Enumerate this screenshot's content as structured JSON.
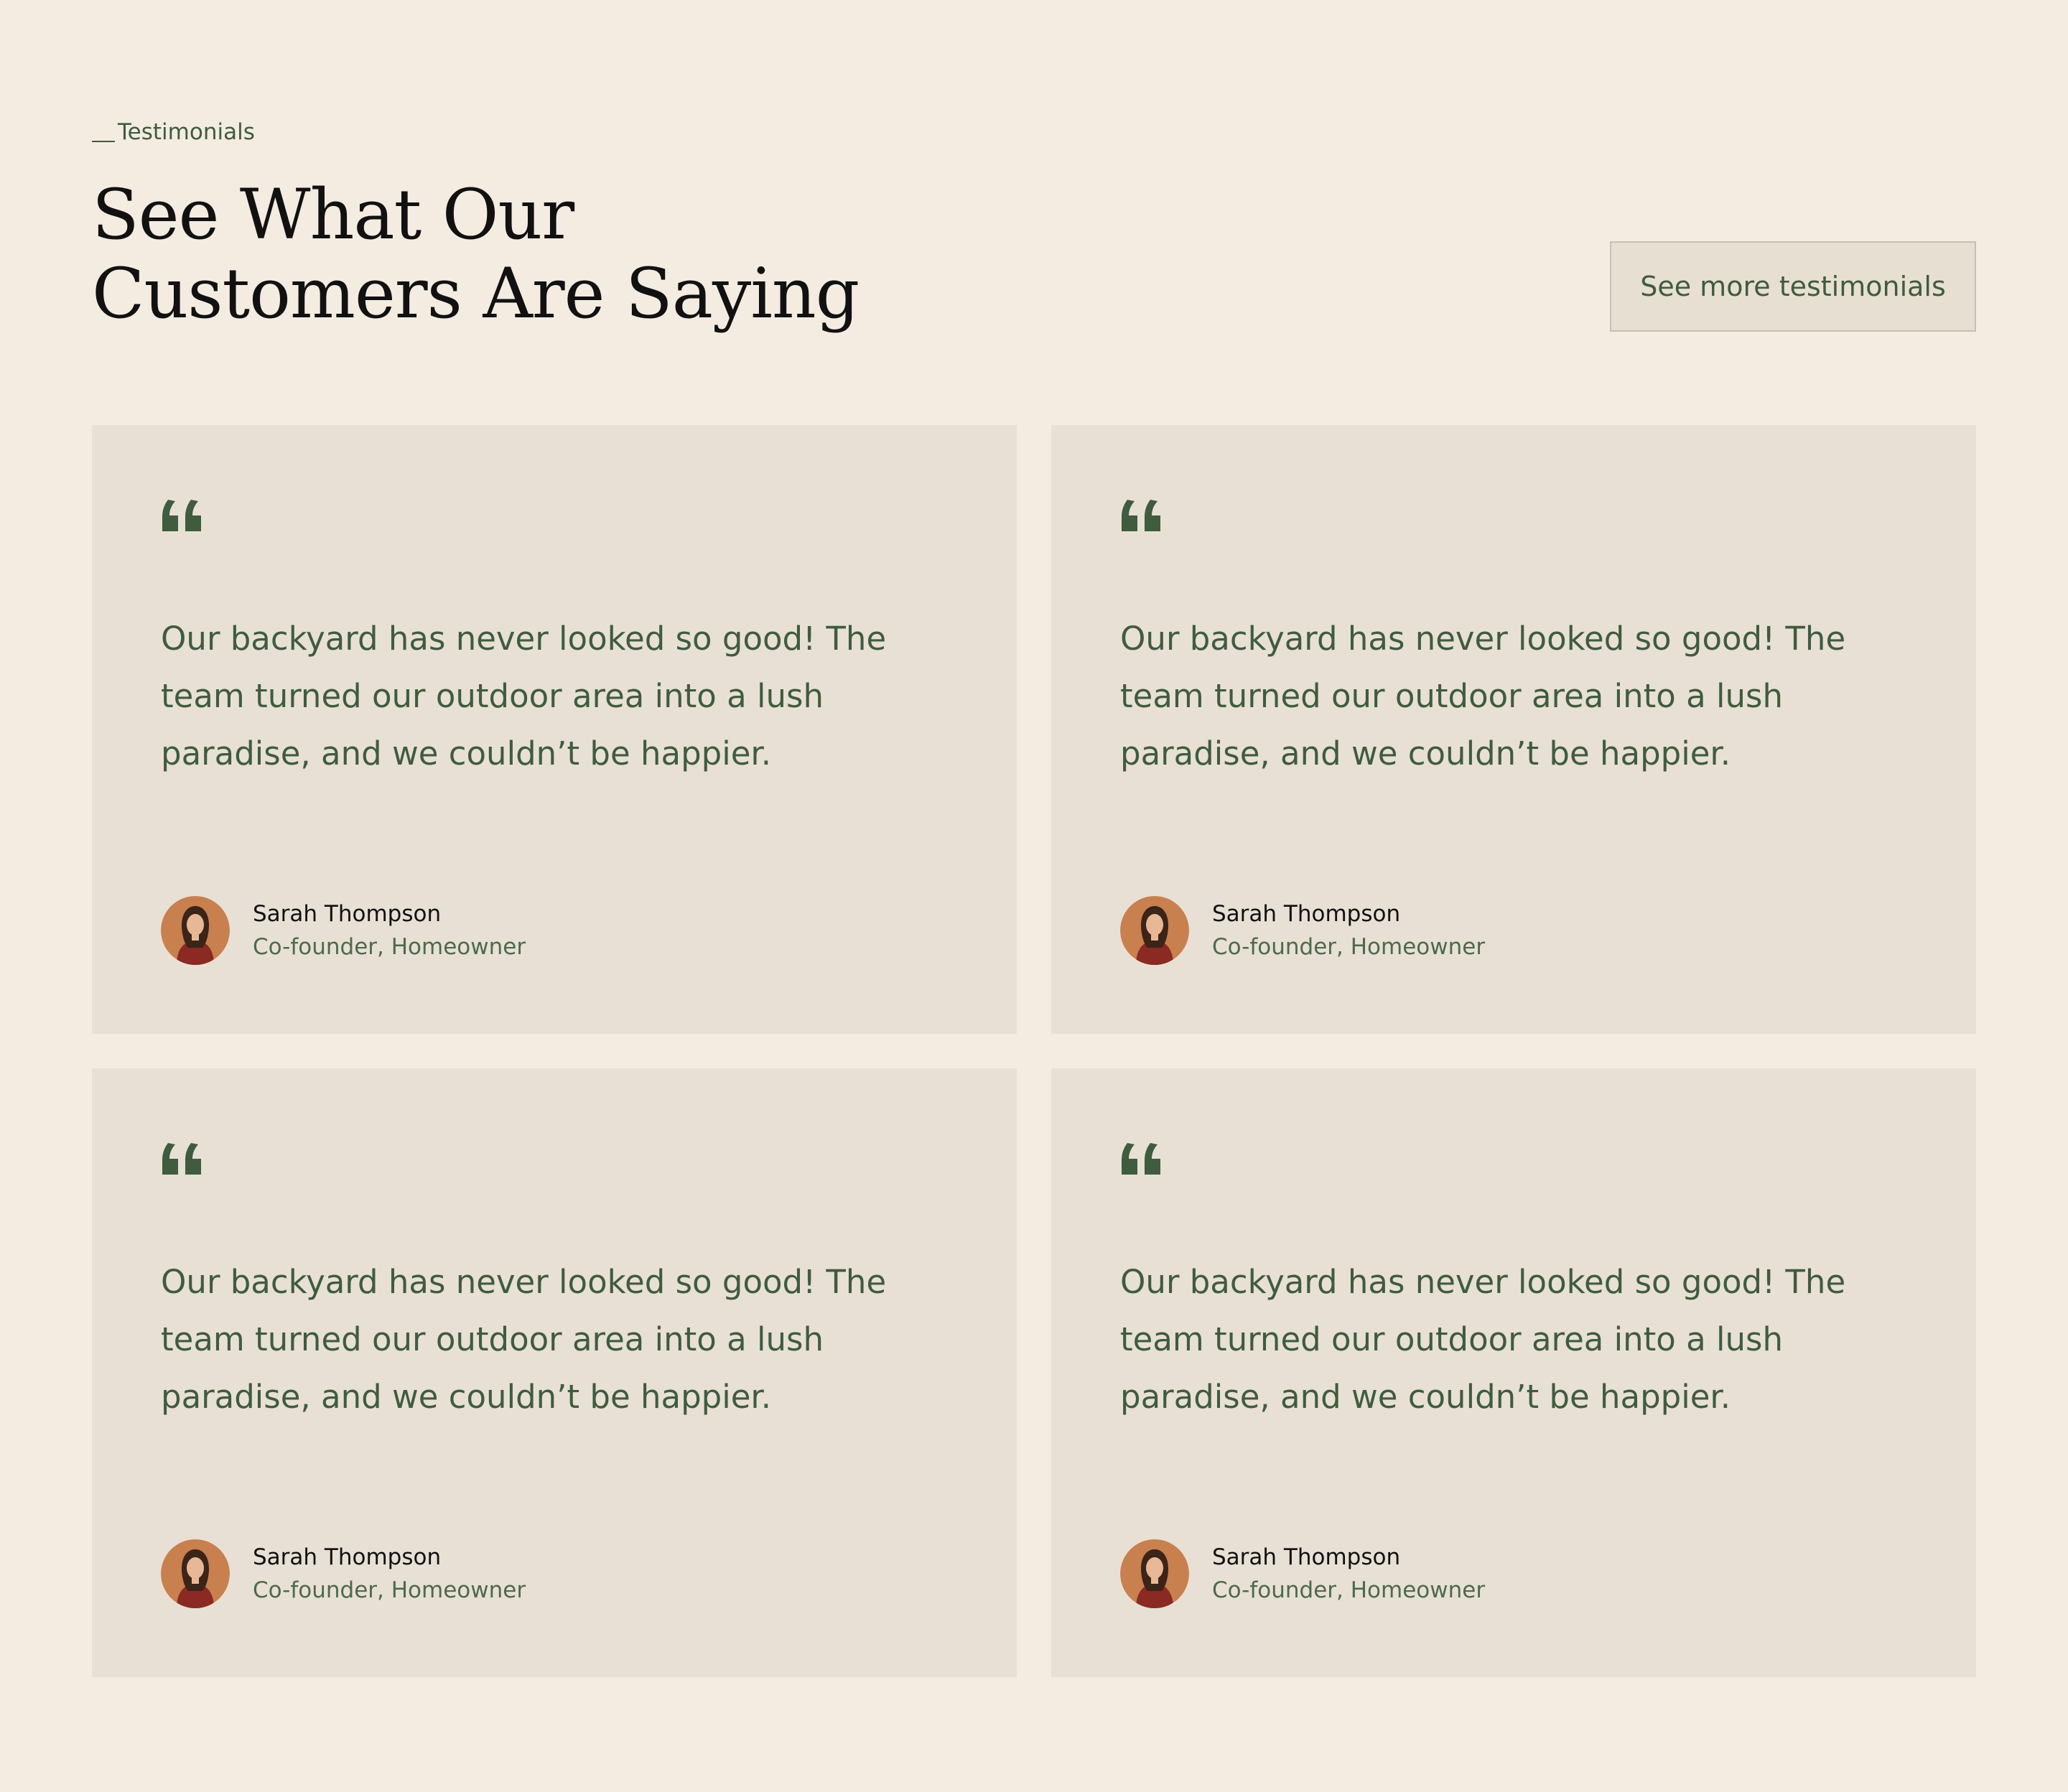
{
  "section": {
    "eyebrow": "Testimonials",
    "title_line1": "See What Our",
    "title_line2": "Customers Are Saying",
    "more_button": "See more testimonials"
  },
  "colors": {
    "background": "#f4ece1",
    "card": "#e8e0d5",
    "accent": "#3f5c3e",
    "heading": "#111111"
  },
  "testimonials": [
    {
      "quote": "Our backyard has never looked so good! The team turned our outdoor area into a lush paradise, and we couldn’t be happier.",
      "name": "Sarah Thompson",
      "role": "Co-founder, Homeowner",
      "icon": "quote-icon"
    },
    {
      "quote": "Our backyard has never looked so good! The team turned our outdoor area into a lush paradise, and we couldn’t be happier.",
      "name": "Sarah Thompson",
      "role": "Co-founder, Homeowner",
      "icon": "quote-icon"
    },
    {
      "quote": "Our backyard has never looked so good! The team turned our outdoor area into a lush paradise, and we couldn’t be happier.",
      "name": "Sarah Thompson",
      "role": "Co-founder, Homeowner",
      "icon": "quote-icon"
    },
    {
      "quote": "Our backyard has never looked so good! The team turned our outdoor area into a lush paradise, and we couldn’t be happier.",
      "name": "Sarah Thompson",
      "role": "Co-founder, Homeowner",
      "icon": "quote-icon"
    }
  ]
}
